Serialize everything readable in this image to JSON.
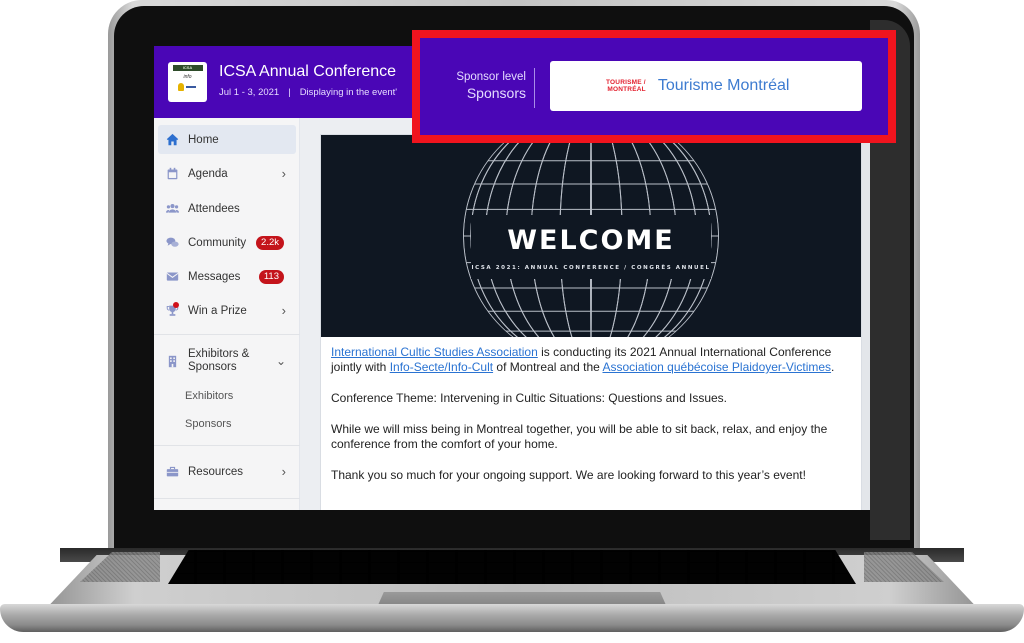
{
  "header": {
    "title": "ICSA Annual Conference",
    "dates": "Jul 1 - 3, 2021",
    "separator": "|",
    "display_note": "Displaying in the event'",
    "logo": {
      "line1": "ICSA",
      "line2": "info"
    }
  },
  "sponsor_banner": {
    "level_label": "Sponsor level",
    "level_value": "Sponsors",
    "logo_text_line1": "TOURISME /",
    "logo_text_line2": "MONTRÉAL",
    "sponsor_name": "Tourisme Montréal",
    "highlight_color": "#f0141e"
  },
  "sidebar": {
    "items": [
      {
        "label": "Home",
        "icon": "home-icon",
        "active": true
      },
      {
        "label": "Agenda",
        "icon": "calendar-icon",
        "chevron": "›"
      },
      {
        "label": "Attendees",
        "icon": "users-icon"
      },
      {
        "label": "Community",
        "icon": "chat-icon",
        "badge": "2.2k"
      },
      {
        "label": "Messages",
        "icon": "envelope-icon",
        "badge": "113"
      },
      {
        "label": "Win a Prize",
        "icon": "trophy-icon",
        "chevron": "›",
        "notification_dot": true
      },
      {
        "label": "Exhibitors & Sponsors",
        "icon": "building-icon",
        "chevron": "⌄",
        "expanded": true,
        "children": [
          {
            "label": "Exhibitors"
          },
          {
            "label": "Sponsors"
          }
        ]
      },
      {
        "label": "Resources",
        "icon": "toolbox-icon",
        "chevron": "›"
      }
    ]
  },
  "main": {
    "banner": {
      "title": "WELCOME",
      "subtitle": "ICSA 2021: ANNUAL CONFERENCE / CONGRÈS ANNUEL"
    },
    "intro": {
      "link1": "International Cultic Studies Association",
      "text1": " is conducting its 2021 Annual International Conference jointly with ",
      "link2": "Info-Secte/Info-Cult",
      "text2": " of Montreal and the ",
      "link3": "Association québécoise Plaidoyer-Victimes",
      "text3": "."
    },
    "theme": "Conference Theme: Intervening in Cultic Situations: Questions and Issues.",
    "para2": "While we will miss being in Montreal together, you will be able to sit back, relax, and enjoy the conference from the comfort of your home.",
    "para3": "Thank you so much for your ongoing support. We are looking forward to this year’s event!"
  },
  "colors": {
    "brand_purple": "#4a06b6",
    "badge_red": "#c4141b",
    "link_blue": "#2a73d2"
  }
}
